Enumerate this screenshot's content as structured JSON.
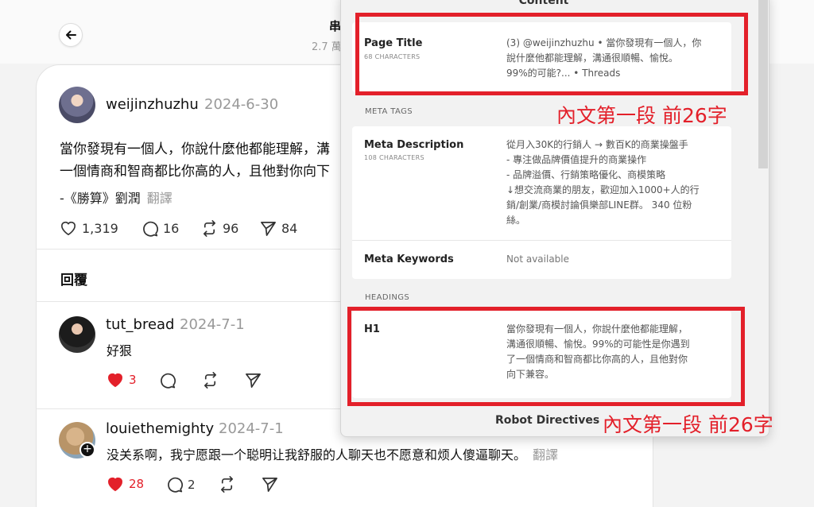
{
  "header": {
    "title": "串",
    "subtitle": "2.7 萬"
  },
  "post": {
    "username": "weijinzhuzhu",
    "date": "2024-6-30",
    "lines": [
      "當你發現有一個人，你說什麼他都能理解，溝",
      "一個情商和智商都比你高的人，且他對你向下"
    ],
    "quote": "-《勝算》劉潤",
    "translate": "翻譯",
    "likes": "1,319",
    "comments": "16",
    "reposts": "96",
    "shares": "84"
  },
  "replies_label": "回覆",
  "comments": [
    {
      "username": "tut_bread",
      "date": "2024-7-1",
      "text": "好狠",
      "likes": "3",
      "comments": "",
      "reposts": ""
    },
    {
      "username": "louiethemighty",
      "date": "2024-7-1",
      "text": "没关系啊，我宁愿跟一个聪明让我舒服的人聊天也不愿意和烦人傻逼聊天。",
      "translate": "翻譯",
      "likes": "28",
      "comments": "2"
    }
  ],
  "seo_panel": {
    "header": "Content",
    "page_title": {
      "label": "Page Title",
      "count": "68 CHARACTERS",
      "value_lines": [
        "(3) @weijinzhuzhu • 當你發現有一個人，你",
        "說什麼他都能理解，溝通很順暢、愉悅。",
        "99%的可能?... • Threads"
      ]
    },
    "meta_tags_label": "META TAGS",
    "meta_description": {
      "label": "Meta Description",
      "count": "108 CHARACTERS",
      "value_lines": [
        "從月入30K的行銷人 → 數百K的商業操盤手",
        "- 專注做品牌價值提升的商業操作",
        "- 品牌溢價、行銷策略優化、商模策略",
        "↓想交流商業的朋友，歡迎加入1000+人的行",
        "銷/創業/商模討論俱樂部LINE群。 340 位粉",
        "絲。"
      ]
    },
    "meta_keywords": {
      "label": "Meta Keywords",
      "value": "Not available"
    },
    "headings_label": "HEADINGS",
    "h1": {
      "label": "H1",
      "value_lines": [
        "當你發現有一個人，你說什麼他都能理解，",
        "溝通很順暢、愉悅。99%的可能性是你遇到",
        "了一個情商和智商都比你高的人，且他對你",
        "向下兼容。"
      ]
    },
    "robot_directives": "Robot Directives"
  },
  "annotations": {
    "note1": "內文第一段 前26字",
    "note2": "內文第一段 前26字",
    "color": "#e3202a"
  }
}
